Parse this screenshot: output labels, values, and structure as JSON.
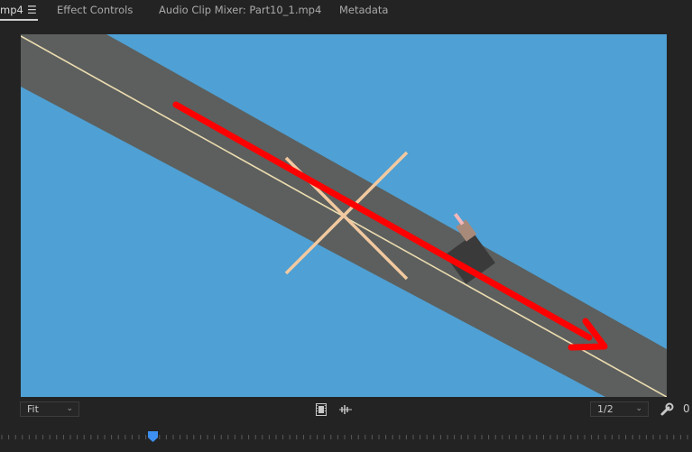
{
  "tabs": [
    {
      "label": "mp4",
      "active": true
    },
    {
      "label": "Effect Controls",
      "active": false
    },
    {
      "label": "Audio Clip Mixer: Part10_1.mp4",
      "active": false
    },
    {
      "label": "Metadata",
      "active": false
    }
  ],
  "tab_menu_icon": "hamburger-menu-icon",
  "controls": {
    "fit_value": "Fit",
    "resolution_value": "1/2",
    "settings_value": "0"
  },
  "icons": {
    "export_frame": "film-strip-icon",
    "audio_waveform": "audio-scrub-icon",
    "settings": "wrench-icon",
    "dropdown": "chevron-down-icon"
  },
  "colors": {
    "sky": "#4fa0d4",
    "road": "#5c5f5d",
    "road_line": "#ecdcb0",
    "cross": "#f2c9a0",
    "arrow": "#ff0000",
    "playhead": "#3d8ff0"
  }
}
